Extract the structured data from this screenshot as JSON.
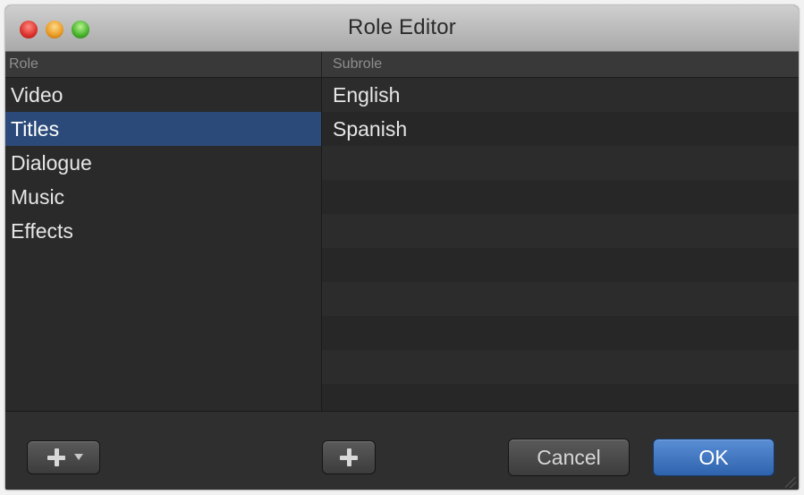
{
  "window": {
    "title": "Role Editor"
  },
  "columns": {
    "role_header": "Role",
    "subrole_header": "Subrole"
  },
  "roles": {
    "items": [
      {
        "label": "Video",
        "selected": false
      },
      {
        "label": "Titles",
        "selected": true
      },
      {
        "label": "Dialogue",
        "selected": false
      },
      {
        "label": "Music",
        "selected": false
      },
      {
        "label": "Effects",
        "selected": false
      }
    ]
  },
  "subroles": {
    "items": [
      {
        "label": "English"
      },
      {
        "label": "Spanish"
      }
    ]
  },
  "footer": {
    "add_role_icon": "plus-icon",
    "add_subrole_icon": "plus-icon",
    "cancel_label": "Cancel",
    "ok_label": "OK"
  },
  "colors": {
    "selection": "#2b4a79",
    "ok_button": "#3a72c0",
    "close": "#d9302a",
    "minimize": "#e89a21",
    "zoom": "#45b02b"
  }
}
